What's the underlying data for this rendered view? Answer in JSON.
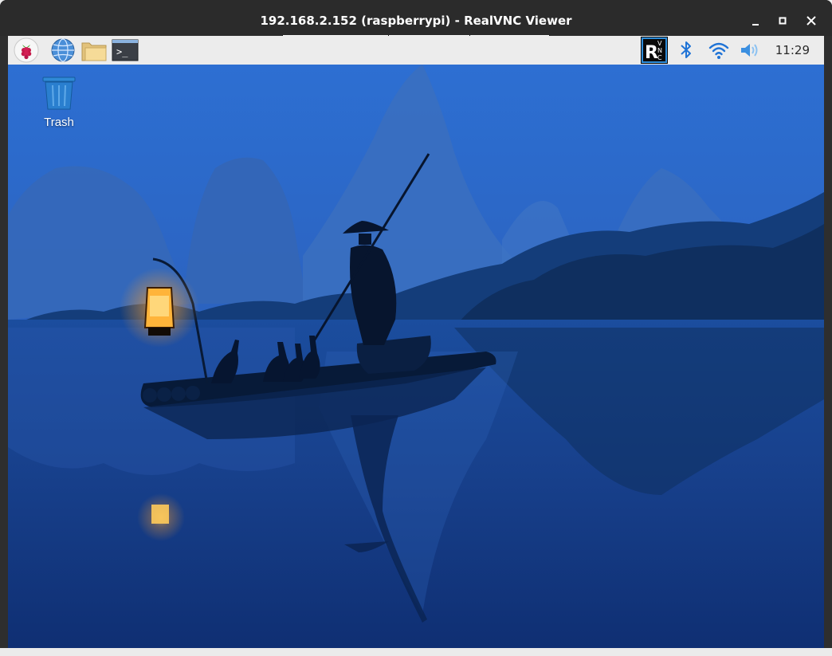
{
  "window": {
    "title": "192.168.2.152 (raspberrypi) - RealVNC Viewer",
    "controls": [
      "minimize-icon",
      "maximize-icon",
      "close-icon"
    ]
  },
  "panel": {
    "launchers": [
      {
        "name": "raspberry-menu-icon"
      },
      {
        "name": "web-browser-icon"
      },
      {
        "name": "file-manager-icon"
      },
      {
        "name": "terminal-icon",
        "glyph": ">_"
      }
    ],
    "tray": [
      {
        "name": "realvnc-server-icon",
        "glyph_r": "R",
        "glyph_v": "V",
        "glyph_n": "N",
        "glyph_c": "C"
      },
      {
        "name": "bluetooth-icon"
      },
      {
        "name": "wifi-icon"
      },
      {
        "name": "volume-icon"
      }
    ],
    "clock": "11:29"
  },
  "desktop": {
    "icons": [
      {
        "name": "trash-icon",
        "label": "Trash"
      }
    ],
    "wallpaper": "misty karst mountains, river, fisherman on bamboo raft with lantern and cormorants"
  },
  "colors": {
    "titlebar": "#2b2b2b",
    "panel": "#ececec",
    "sky": "#2f6fd0",
    "water": "#123a86",
    "lantern": "#ffb43a"
  }
}
